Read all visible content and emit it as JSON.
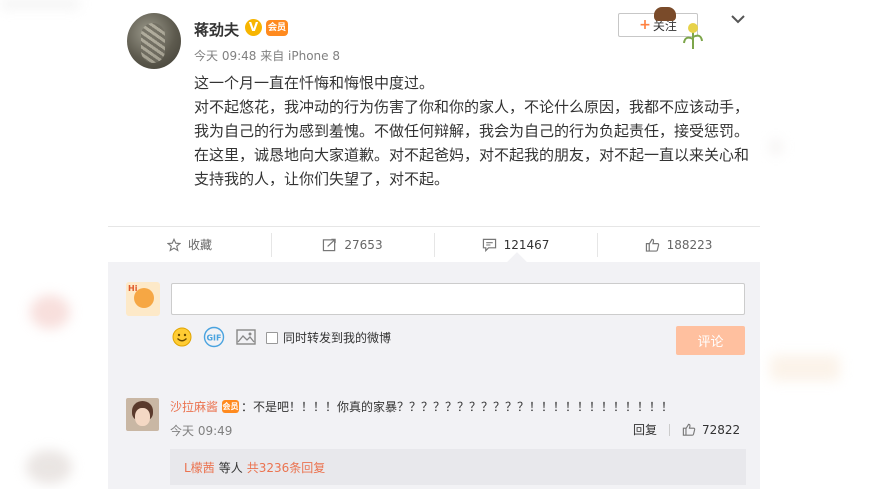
{
  "post": {
    "author": "蒋劲夫",
    "verified_badge": "V",
    "vip_badge": "会员",
    "meta": "今天 09:48 来自 iPhone 8",
    "follow_label": "关注",
    "follow_plus": "+",
    "paragraphs": [
      "这一个月一直在忏悔和悔恨中度过。",
      "对不起悠花，我冲动的行为伤害了你和你的家人，不论什么原因，我都不应该动手，我为自己的行为感到羞愧。不做任何辩解，我会为自己的行为负起责任，接受惩罚。",
      "在这里，诚恳地向大家道歉。对不起爸妈，对不起我的朋友，对不起一直以来关心和支持我的人，让你们失望了，对不起。"
    ]
  },
  "actions": {
    "favorite": "收藏",
    "repost": "27653",
    "comment": "121467",
    "like": "188223"
  },
  "comment_box": {
    "placeholder": "",
    "repost_option": "同时转发到我的微博",
    "submit": "评论"
  },
  "top_comment": {
    "user": "沙拉麻酱",
    "vip_badge": "会员",
    "text": "：不是吧！！！！你真的家暴？？？？？？？？？？？！！！！！！！！！！！！",
    "time": "今天 09:49",
    "reply_label": "回复",
    "likes": "72822",
    "sub_user": "L檬茜",
    "sub_mid": "等人",
    "sub_total": "共3236条回复"
  },
  "colors": {
    "accent": "#eb7350",
    "submit_disabled": "#ffc09f",
    "comment_bg": "#f2f2f5"
  }
}
